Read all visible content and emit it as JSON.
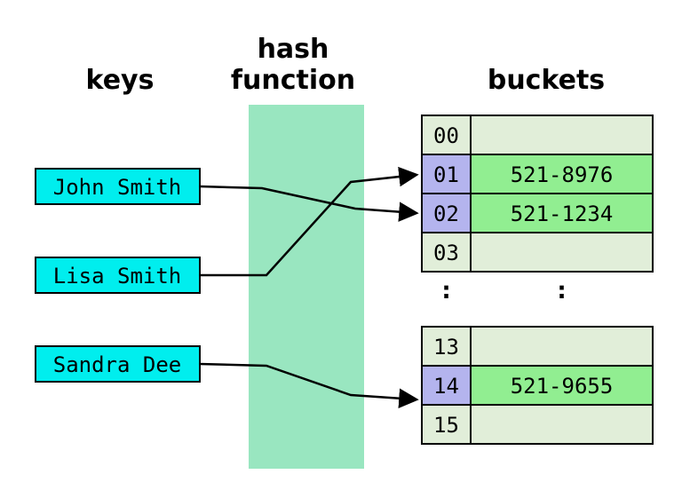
{
  "headings": {
    "keys": "keys",
    "hash1": "hash",
    "hash2": "function",
    "buckets": "buckets"
  },
  "keys": [
    {
      "label": "John Smith"
    },
    {
      "label": "Lisa Smith"
    },
    {
      "label": "Sandra Dee"
    }
  ],
  "table": {
    "top": [
      {
        "index": "00",
        "value": "",
        "filled": false
      },
      {
        "index": "01",
        "value": "521-8976",
        "filled": true
      },
      {
        "index": "02",
        "value": "521-1234",
        "filled": true
      },
      {
        "index": "03",
        "value": "",
        "filled": false
      }
    ],
    "bottom": [
      {
        "index": "13",
        "value": "",
        "filled": false
      },
      {
        "index": "14",
        "value": "521-9655",
        "filled": true
      },
      {
        "index": "15",
        "value": "",
        "filled": false
      }
    ],
    "ellipsis": ":"
  },
  "mapping_note": "John Smith→02, Lisa Smith→01, Sandra Dee→14"
}
